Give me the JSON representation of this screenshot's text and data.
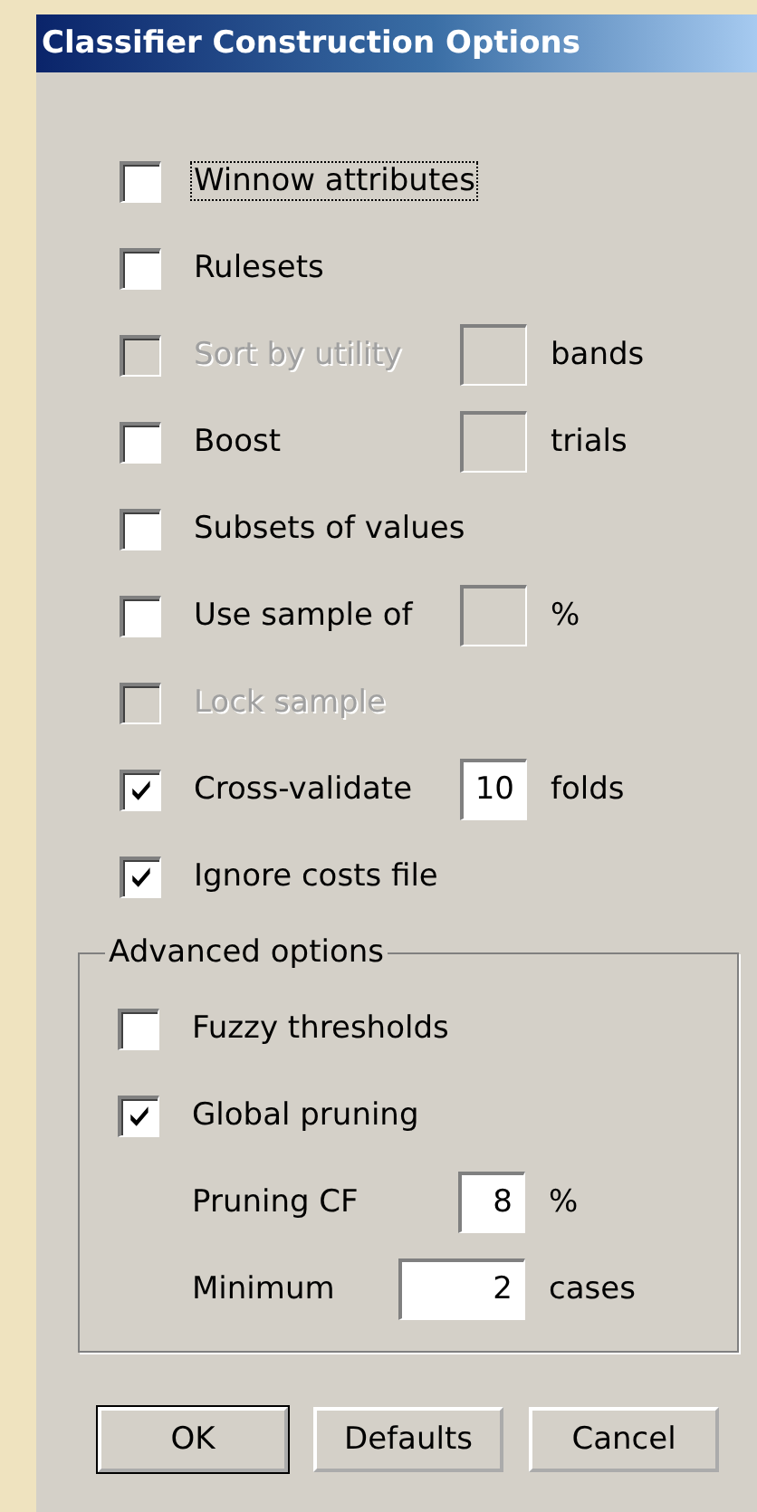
{
  "window": {
    "title": "Classifier Construction Options"
  },
  "options": [
    {
      "kind": "check",
      "label": "Winnow attributes",
      "checked": false,
      "disabled": false,
      "focused": true
    },
    {
      "kind": "check",
      "label": "Rulesets",
      "checked": false,
      "disabled": false,
      "focused": false
    },
    {
      "kind": "check",
      "label": "Sort by utility",
      "checked": false,
      "disabled": true,
      "focused": false,
      "field": {
        "kind": "narrow"
      },
      "unit": "bands"
    },
    {
      "kind": "check",
      "label": "Boost",
      "checked": false,
      "disabled": false,
      "focused": false,
      "field": {
        "kind": "narrow"
      },
      "unit": "trials"
    },
    {
      "kind": "check",
      "label": "Subsets of values",
      "checked": false,
      "disabled": false,
      "focused": false
    },
    {
      "kind": "check",
      "label": "Use sample of",
      "checked": false,
      "disabled": false,
      "focused": false,
      "field": {
        "kind": "narrow"
      },
      "unit": "%"
    },
    {
      "kind": "check",
      "label": "Lock sample",
      "checked": false,
      "disabled": true,
      "focused": false
    },
    {
      "kind": "check",
      "label": "Cross-validate",
      "checked": true,
      "disabled": false,
      "focused": false,
      "field": {
        "kind": "narrow",
        "value": "10"
      },
      "unit": "folds"
    },
    {
      "kind": "check",
      "label": "Ignore costs file",
      "checked": true,
      "disabled": false,
      "focused": false
    }
  ],
  "advanced": {
    "legend": "Advanced options",
    "options": [
      {
        "kind": "check",
        "label": "Fuzzy thresholds",
        "checked": false,
        "disabled": false,
        "focused": false
      },
      {
        "kind": "check",
        "label": "Global pruning",
        "checked": true,
        "disabled": false,
        "focused": false
      },
      {
        "kind": "value",
        "label": "Pruning CF",
        "field": {
          "kind": "narrow",
          "value": "8"
        },
        "unit": "%"
      },
      {
        "kind": "value",
        "label": "Minimum",
        "field": {
          "kind": "wide",
          "value": "2"
        },
        "unit": "cases"
      }
    ]
  },
  "buttons": [
    {
      "label": "OK",
      "default": true
    },
    {
      "label": "Defaults",
      "default": false
    },
    {
      "label": "Cancel",
      "default": false
    }
  ]
}
